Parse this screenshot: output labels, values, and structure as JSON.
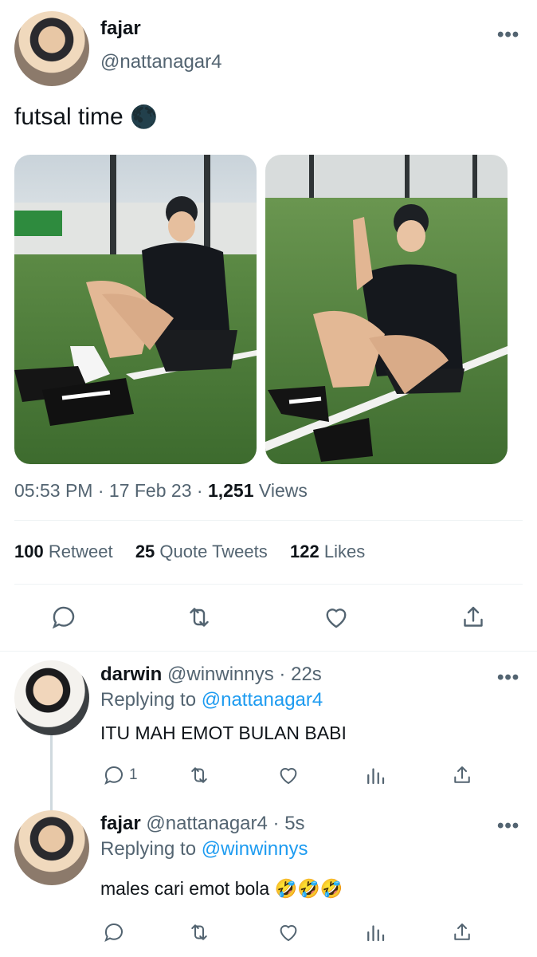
{
  "tweet": {
    "author": {
      "name": "fajar",
      "handle": "@nattanagar4"
    },
    "text": "futsal time",
    "emoji": "🌑",
    "time": "05:53 PM",
    "date": "17 Feb 23",
    "views_count": "1,251",
    "views_label": "Views",
    "retweets": "100",
    "retweets_label": "Retweet",
    "quotes": "25",
    "quotes_label": "Quote Tweets",
    "likes": "122",
    "likes_label": "Likes",
    "more": "•••"
  },
  "replies": [
    {
      "name": "darwin",
      "handle": "@winwinnys",
      "time": "22s",
      "replying_prefix": "Replying to",
      "replying_to": "@nattanagar4",
      "text": "ITU MAH EMOT BULAN BABI",
      "reply_count": "1"
    },
    {
      "name": "fajar",
      "handle": "@nattanagar4",
      "time": "5s",
      "replying_prefix": "Replying to",
      "replying_to": "@winwinnys",
      "text": "males cari emot bola 🤣🤣🤣",
      "reply_count": ""
    }
  ],
  "separators": {
    "dot": "·"
  },
  "colors": {
    "accent": "#1d9bf0",
    "secondary_text": "#536471",
    "divider": "#eff3f4"
  }
}
